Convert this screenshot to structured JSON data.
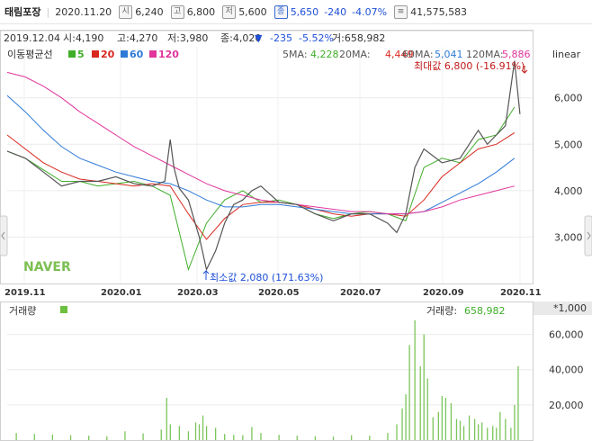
{
  "header": {
    "name": "태림포장",
    "date": "2020.11.20",
    "open_label": "시",
    "open": "6,240",
    "high_label": "고",
    "high": "6,800",
    "low_label": "저",
    "low": "5,600",
    "close_label": "종",
    "close": "5,650",
    "change": "-240",
    "change_pct": "-4.07%",
    "volume": "41,575,583"
  },
  "info_bar": {
    "date": "2019.12.04",
    "open": "시:4,190",
    "high": "고:4,270",
    "low": "저:3,980",
    "close": "종:4,020",
    "arrow": "▼",
    "change": "-235",
    "change_pct": "-5.52%",
    "volume": "거:658,982"
  },
  "ma_legend": {
    "label": "이동평균선",
    "items": [
      "5",
      "20",
      "60",
      "120"
    ],
    "colors": [
      "#3fae29",
      "#d9281f",
      "#2f7ad6",
      "#e1359c"
    ]
  },
  "ma_values": {
    "ma5_label": "5MA:",
    "ma5": "4,228",
    "ma20_label": "20MA:",
    "ma20": "4,449",
    "ma60_label": "60MA:",
    "ma60": "5,041",
    "ma120_label": "120MA:",
    "ma120": "5,886"
  },
  "scale_label": "linear",
  "annotations": {
    "max": "최대값 6,800 (-16.91%)",
    "min": "최소값 2,080 (171.63%)"
  },
  "watermark": "NAVER",
  "volume_panel": {
    "label": "거래량",
    "value_label": "거래량:",
    "value": "658,982",
    "unit": "*1,000"
  },
  "chart_data": {
    "type": "candlestick",
    "x_tick_labels": [
      "2019.11",
      "2020.01",
      "2020.03",
      "2020.05",
      "2020.07",
      "2020.09",
      "2020.11"
    ],
    "y_ticks": [
      3000,
      4000,
      5000,
      6000
    ],
    "y_tick_labels": [
      "3,000",
      "4,000",
      "5,000",
      "6,000"
    ],
    "ylim": [
      2000,
      7100
    ],
    "volume_y_ticks": [
      20000,
      40000,
      60000
    ],
    "volume_y_tick_labels": [
      "20,000",
      "40,000",
      "60,000"
    ],
    "volume_ylim": [
      0,
      70000
    ],
    "grid": true,
    "series": [
      {
        "name": "5",
        "x": [
          0,
          10,
          20,
          30,
          40,
          50,
          60,
          70,
          80,
          90,
          100,
          110,
          120,
          130,
          140,
          150,
          160,
          170,
          180,
          190,
          200,
          210,
          220,
          230,
          240,
          250,
          260,
          270,
          280
        ],
        "values": [
          4850,
          4700,
          4450,
          4200,
          4200,
          4100,
          4150,
          4200,
          4100,
          3900,
          2300,
          3300,
          3800,
          4000,
          3750,
          3800,
          3700,
          3500,
          3400,
          3500,
          3550,
          3500,
          3350,
          4500,
          4700,
          4600,
          5100,
          5200,
          5800
        ]
      },
      {
        "name": "20",
        "x": [
          0,
          10,
          20,
          30,
          40,
          50,
          60,
          70,
          80,
          90,
          100,
          110,
          120,
          130,
          140,
          150,
          160,
          170,
          180,
          190,
          200,
          210,
          220,
          230,
          240,
          250,
          260,
          270,
          280
        ],
        "values": [
          5200,
          4900,
          4600,
          4400,
          4250,
          4200,
          4150,
          4100,
          4150,
          4100,
          3500,
          2950,
          3400,
          3700,
          3750,
          3750,
          3700,
          3600,
          3500,
          3450,
          3500,
          3500,
          3450,
          3800,
          4300,
          4600,
          4900,
          5000,
          5250
        ]
      },
      {
        "name": "60",
        "x": [
          0,
          10,
          20,
          30,
          40,
          50,
          60,
          70,
          80,
          90,
          100,
          110,
          120,
          130,
          140,
          150,
          160,
          170,
          180,
          190,
          200,
          210,
          220,
          230,
          240,
          250,
          260,
          270,
          280
        ],
        "values": [
          6050,
          5700,
          5300,
          4950,
          4700,
          4550,
          4400,
          4300,
          4200,
          4150,
          4000,
          3800,
          3650,
          3650,
          3700,
          3700,
          3650,
          3600,
          3550,
          3500,
          3500,
          3500,
          3500,
          3550,
          3750,
          3950,
          4150,
          4400,
          4700
        ]
      },
      {
        "name": "120",
        "x": [
          0,
          10,
          20,
          30,
          40,
          50,
          60,
          70,
          80,
          90,
          100,
          110,
          120,
          130,
          140,
          150,
          160,
          170,
          180,
          190,
          200,
          210,
          220,
          230,
          240,
          250,
          260,
          270,
          280
        ],
        "values": [
          6550,
          6450,
          6250,
          6000,
          5700,
          5450,
          5200,
          4950,
          4750,
          4550,
          4350,
          4150,
          4000,
          3900,
          3800,
          3750,
          3700,
          3650,
          3600,
          3550,
          3550,
          3500,
          3500,
          3550,
          3650,
          3800,
          3900,
          4000,
          4100
        ]
      }
    ],
    "price_path": {
      "x": [
        0,
        10,
        20,
        30,
        40,
        50,
        60,
        70,
        80,
        87,
        90,
        92,
        95,
        100,
        106,
        110,
        115,
        120,
        125,
        130,
        135,
        140,
        150,
        160,
        170,
        180,
        190,
        200,
        210,
        215,
        220,
        225,
        230,
        240,
        250,
        260,
        265,
        270,
        275,
        280,
        283
      ],
      "values": [
        4850,
        4700,
        4400,
        4100,
        4200,
        4200,
        4300,
        4150,
        4100,
        4200,
        5100,
        4500,
        4050,
        3800,
        3000,
        2300,
        2700,
        3300,
        3700,
        3800,
        4000,
        4100,
        3750,
        3700,
        3500,
        3350,
        3500,
        3500,
        3300,
        3100,
        3500,
        4500,
        4900,
        4600,
        4700,
        5300,
        5000,
        5200,
        5400,
        6800,
        5650
      ]
    },
    "volume": {
      "x": [
        5,
        15,
        25,
        35,
        45,
        55,
        65,
        75,
        85,
        88,
        90,
        95,
        100,
        104,
        106,
        108,
        110,
        115,
        120,
        125,
        130,
        135,
        140,
        150,
        160,
        170,
        180,
        190,
        200,
        210,
        215,
        218,
        220,
        222,
        225,
        228,
        230,
        232,
        235,
        238,
        240,
        242,
        245,
        248,
        250,
        252,
        255,
        258,
        260,
        262,
        265,
        268,
        270,
        272,
        275,
        278,
        280,
        282
      ],
      "values": [
        4000,
        3500,
        3200,
        2800,
        2500,
        2200,
        5000,
        3800,
        6000,
        24000,
        9000,
        8000,
        5000,
        10000,
        9000,
        14000,
        8000,
        7000,
        3500,
        3000,
        2800,
        7500,
        4000,
        3000,
        2500,
        2200,
        2000,
        2800,
        2500,
        4000,
        9000,
        18000,
        26000,
        54000,
        68000,
        42000,
        60000,
        35000,
        13000,
        16000,
        25000,
        24000,
        21000,
        12000,
        11000,
        8000,
        14000,
        12000,
        9000,
        10000,
        7000,
        8000,
        7000,
        16000,
        12000,
        7000,
        20000,
        42000
      ]
    }
  }
}
